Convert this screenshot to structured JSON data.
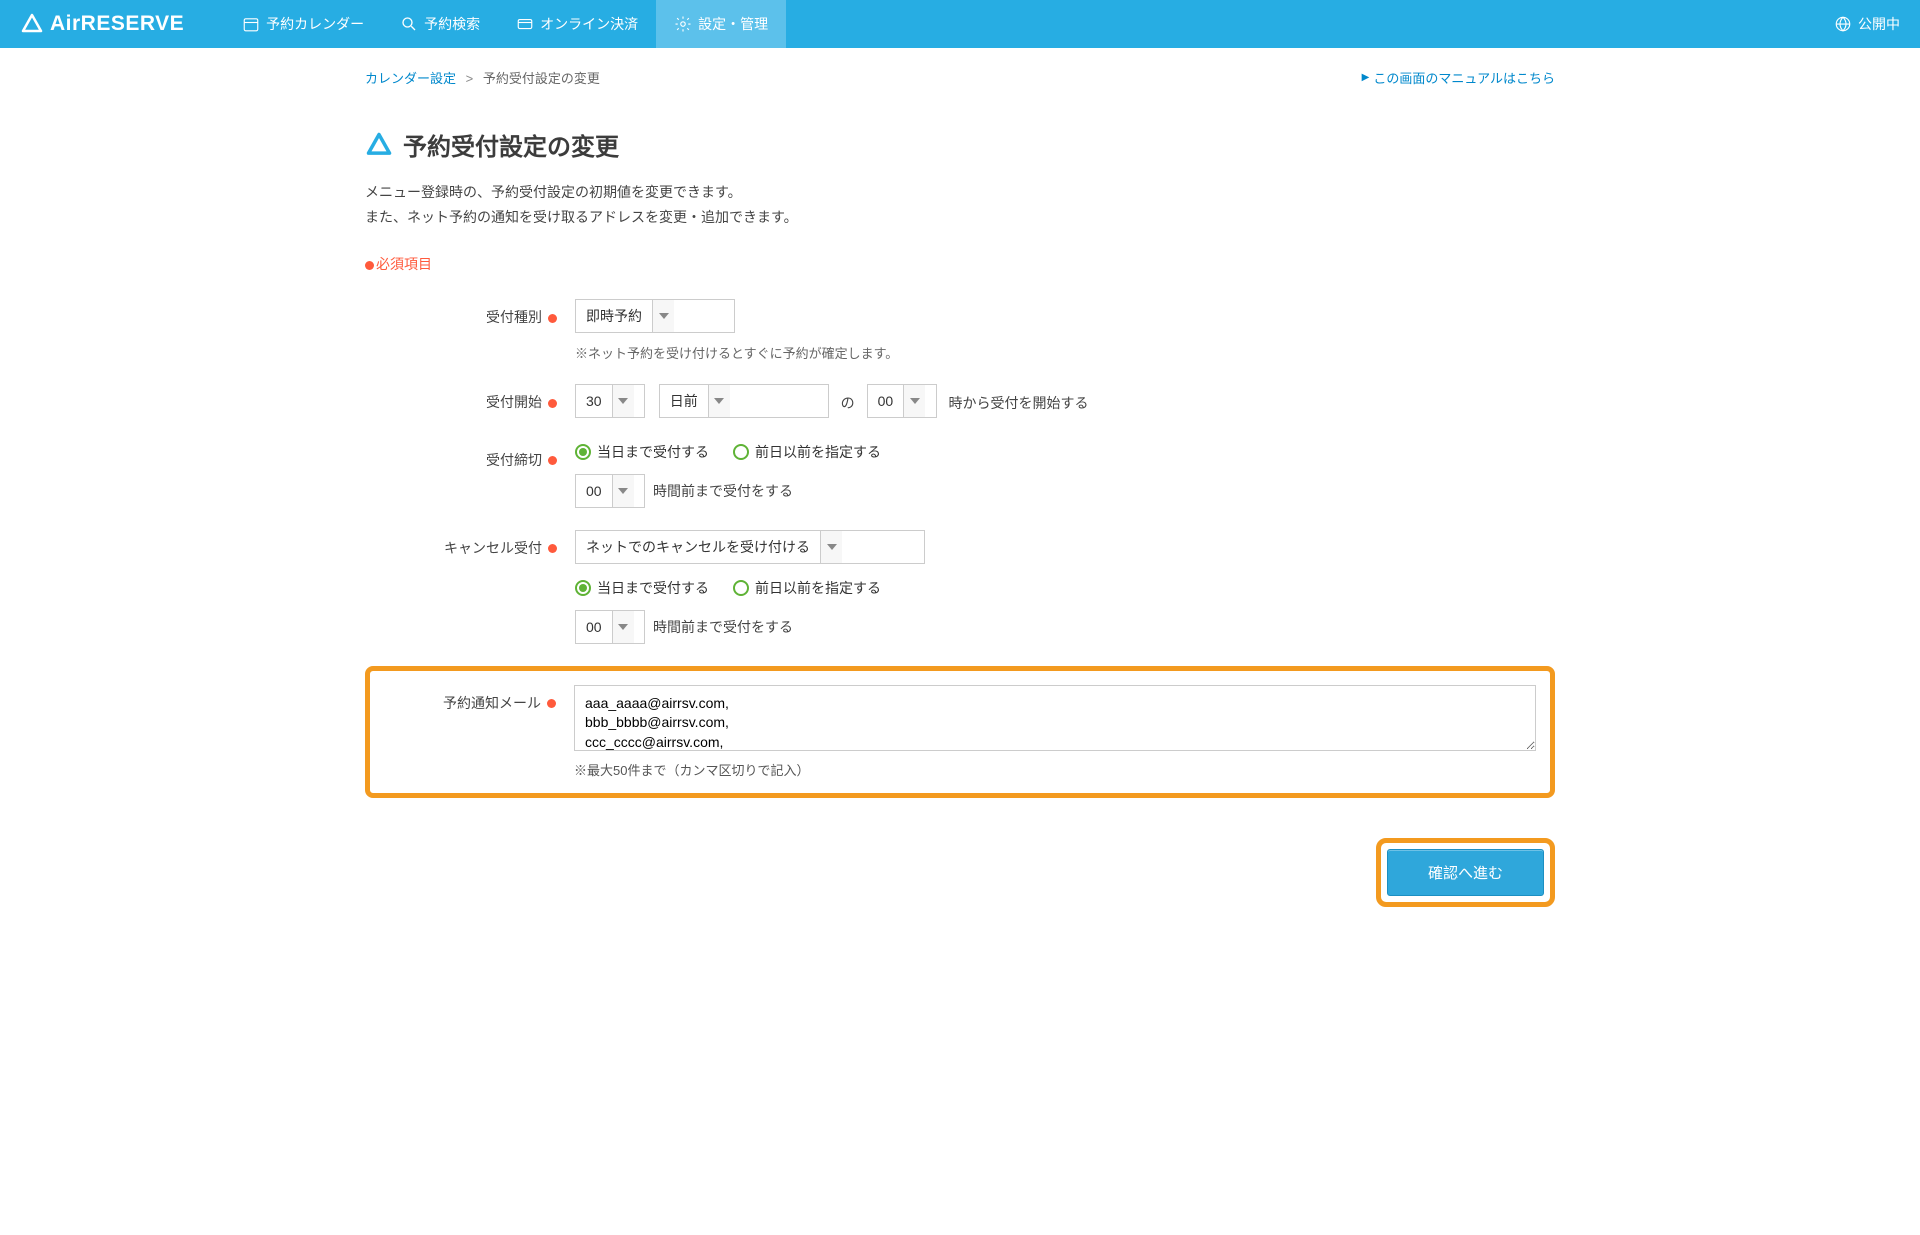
{
  "header": {
    "logo_text": "AirRESERVE",
    "nav": [
      {
        "label": "予約カレンダー"
      },
      {
        "label": "予約検索"
      },
      {
        "label": "オンライン決済"
      },
      {
        "label": "設定・管理"
      }
    ],
    "status_label": "公開中"
  },
  "breadcrumb": {
    "parent": "カレンダー設定",
    "sep": ">",
    "current": "予約受付設定の変更"
  },
  "manual_link": "この画面のマニュアルはこちら",
  "page_title": "予約受付設定の変更",
  "description_line1": "メニュー登録時の、予約受付設定の初期値を変更できます。",
  "description_line2": "また、ネット予約の通知を受け取るアドレスを変更・追加できます。",
  "required_note": "必須項目",
  "form": {
    "reception_type": {
      "label": "受付種別",
      "value": "即時予約",
      "hint": "※ネット予約を受け付けるとすぐに予約が確定します。"
    },
    "reception_start": {
      "label": "受付開始",
      "days_value": "30",
      "unit_value": "日前",
      "middle_text": "の",
      "hour_value": "00",
      "suffix": "時から受付を開始する"
    },
    "reception_deadline": {
      "label": "受付締切",
      "radio1": "当日まで受付する",
      "radio2": "前日以前を指定する",
      "hour_value": "00",
      "suffix": "時間前まで受付をする"
    },
    "cancel": {
      "label": "キャンセル受付",
      "value": "ネットでのキャンセルを受け付ける",
      "radio1": "当日まで受付する",
      "radio2": "前日以前を指定する",
      "hour_value": "00",
      "suffix": "時間前まで受付をする"
    },
    "notify_email": {
      "label": "予約通知メール",
      "value": "aaa_aaaa@airrsv.com,\nbbb_bbbb@airrsv.com,\nccc_cccc@airrsv.com,",
      "hint": "※最大50件まで（カンマ区切りで記入）"
    }
  },
  "submit_label": "確認へ進む"
}
